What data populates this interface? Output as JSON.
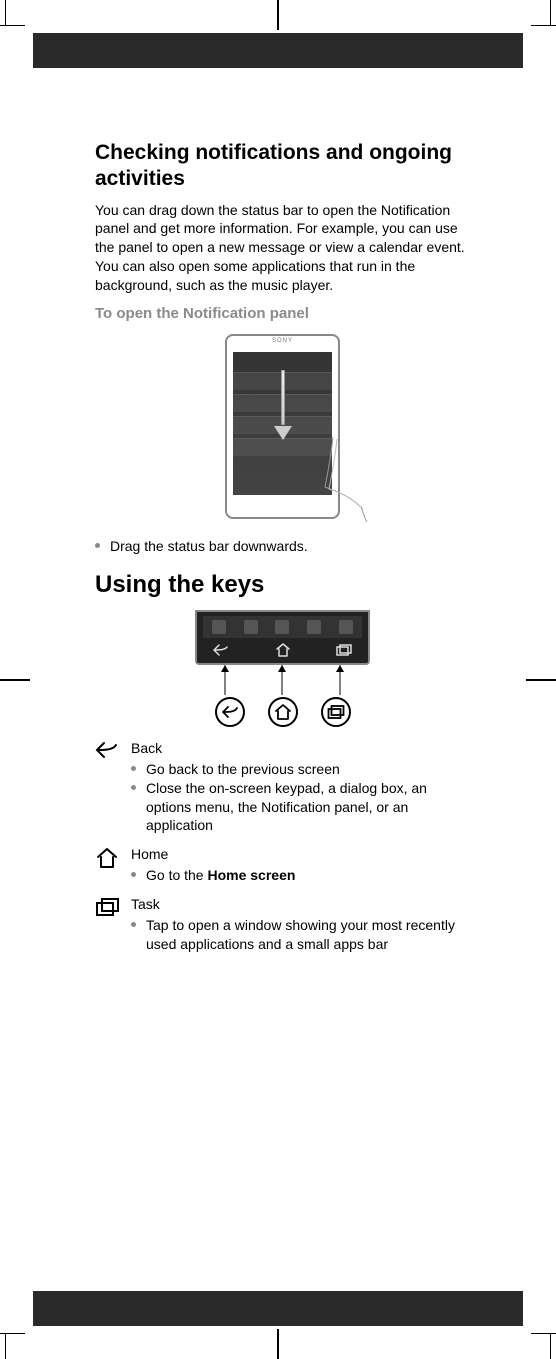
{
  "section1": {
    "heading": "Checking notifications and ongoing activities",
    "intro": "You can drag down the status bar to open the Notification panel and get more information. For example, you can use the panel to open a new message or view a calendar event. You can also open some applications that run in the background, such as the music player.",
    "subheading": "To open the Notification panel",
    "phone_brand": "SONY",
    "bullet": "Drag the status bar downwards."
  },
  "section2": {
    "heading": "Using the keys",
    "keys": [
      {
        "title": "Back",
        "points": [
          "Go back to the previous screen",
          "Close the on-screen keypad, a dialog box, an options menu, the Notification panel, or an application"
        ]
      },
      {
        "title": "Home",
        "points_bold": [
          {
            "pre": "Go to the ",
            "bold": "Home screen",
            "post": ""
          }
        ]
      },
      {
        "title": "Task",
        "points": [
          "Tap to open a window showing your most recently used applications and a small apps bar"
        ]
      }
    ]
  }
}
